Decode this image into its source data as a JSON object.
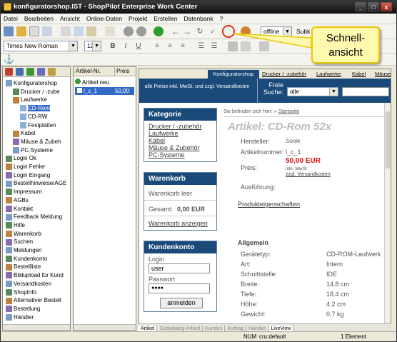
{
  "title": "konfiguratorshop.IST - ShopPilot Enterprise Work Center",
  "window_buttons": [
    "_",
    "□",
    "x"
  ],
  "menu": [
    "Datei",
    "Bearbeiten",
    "Ansicht",
    "Online-Daten",
    "Projekt",
    "Erstellen",
    "Datenbank",
    "?"
  ],
  "toolbar": {
    "mode": "offline",
    "search_label": "Subk"
  },
  "format": {
    "font": "Times New Roman",
    "size": "12"
  },
  "callout": {
    "line1": "Schnell-",
    "line2": "ansicht"
  },
  "tree": [
    {
      "label": "Konfiguratorshop",
      "indent": 1
    },
    {
      "label": "Drucker / -zube",
      "indent": 2
    },
    {
      "label": "Laufwerke",
      "indent": 2
    },
    {
      "label": "CD-Rom",
      "indent": 3,
      "selected": true
    },
    {
      "label": "CD-RW",
      "indent": 3
    },
    {
      "label": "Festplatten",
      "indent": 3
    },
    {
      "label": "Kabel",
      "indent": 2
    },
    {
      "label": "Mäuse & Zubeh",
      "indent": 2
    },
    {
      "label": "PC-Systeme",
      "indent": 2
    },
    {
      "label": "Login Ok",
      "indent": 1
    },
    {
      "label": "Login Fehler",
      "indent": 1
    },
    {
      "label": "Login Eingang",
      "indent": 1
    },
    {
      "label": "Bestellhinweise/AGE",
      "indent": 1
    },
    {
      "label": "Impressum",
      "indent": 1
    },
    {
      "label": "AGBs",
      "indent": 1
    },
    {
      "label": "Kontakt",
      "indent": 1
    },
    {
      "label": "Feedback Meldung",
      "indent": 1
    },
    {
      "label": "Hilfe",
      "indent": 1
    },
    {
      "label": "Warenkorb",
      "indent": 1
    },
    {
      "label": "Suchen",
      "indent": 1
    },
    {
      "label": "Meldungen",
      "indent": 1
    },
    {
      "label": "Kundenkonto",
      "indent": 1
    },
    {
      "label": "Bestellliste",
      "indent": 1
    },
    {
      "label": "Bildupload für Kund",
      "indent": 1
    },
    {
      "label": "Versandkosten",
      "indent": 1
    },
    {
      "label": "ShopInfo",
      "indent": 1
    },
    {
      "label": "Alternativer Bestell",
      "indent": 1
    },
    {
      "label": "Bestellung",
      "indent": 1
    },
    {
      "label": "Händler",
      "indent": 1
    }
  ],
  "articles": {
    "col1": "Artikel-Nr.",
    "col2": "Preis",
    "new": "Artikel neu",
    "rows": [
      {
        "nr": "l_c_1",
        "price": "50,00"
      }
    ]
  },
  "webtabs": [
    "Konfiguratorshop",
    "Drucker / -zubehör",
    "Laufwerke",
    "Kabel",
    "Mäuse"
  ],
  "header_note": "alle Preise inkl. MwSt. und zzgl. Versandkosten",
  "search": {
    "label1": "Freie",
    "label2": "Suche:",
    "value": "alle"
  },
  "kategorie": {
    "title": "Kategorie",
    "items": [
      "Drucker / -zubehör",
      "Laufwerke",
      "Kabel",
      "Mäuse & Zubehör",
      "PC-Systeme"
    ]
  },
  "warenkorb": {
    "title": "Warenkorb",
    "empty": "Warenkorb leer",
    "total_label": "Gesamt:",
    "total": "0,00 EUR",
    "show": "Warenkorb anzeigen"
  },
  "kundenkonto": {
    "title": "Kundenkonto",
    "login_label": "Login",
    "login": "user",
    "pw_label": "Passwort",
    "pw": "●●●●",
    "button": "anmelden"
  },
  "breadcrumb": {
    "prefix": "Sie befinden sich hier: »",
    "link": "Startseite"
  },
  "product": {
    "title": "Artikel: CD-Rom 52x",
    "hersteller_l": "Hersteller:",
    "hersteller": "Sonie",
    "nr_l": "Artikelnummer:",
    "nr": "l_c_1",
    "preis_l": "Preis:",
    "preis": "50,00 EUR",
    "mwst": "inkl. MwSt",
    "versand": "zzgl. Versandkosten",
    "ausf": "Ausführung:",
    "props": "Produkteigenschaften"
  },
  "allgemein": {
    "title": "Allgemein",
    "rows": [
      [
        "Gerätetyp:",
        "CD-ROM-Laufwerk"
      ],
      [
        "Art:",
        "Intern"
      ],
      [
        "Schnittstelle:",
        "IDE"
      ],
      [
        "Breite:",
        "14.8 cm"
      ],
      [
        "Tiefe:",
        "18.4 cm"
      ],
      [
        "Höhe:",
        "4.2 cm"
      ],
      [
        "Gewicht:",
        "0.7 kg"
      ]
    ]
  },
  "bottomtabs": [
    "Artikel",
    "Subkatalog-Artikel",
    "Kunden",
    "Auftrag",
    "Händler",
    "LiveView"
  ],
  "statusbar": {
    "num": "NUM",
    "db": "cru:default",
    "count": "1 Element"
  }
}
